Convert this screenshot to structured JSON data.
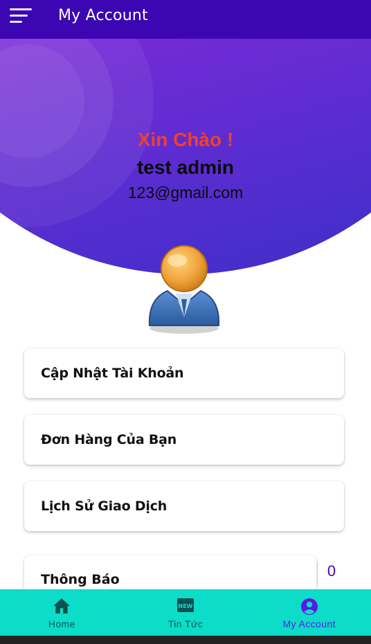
{
  "app_bar": {
    "title": "My Account",
    "menu_icon": "menu-icon"
  },
  "profile": {
    "greeting": "Xin Chào !",
    "name": "test admin",
    "email": "123@gmail.com",
    "avatar_icon": "user-avatar-icon"
  },
  "menu": [
    {
      "label": "Cập Nhật Tài Khoản"
    },
    {
      "label": "Đơn Hàng Của Bạn"
    },
    {
      "label": "Lịch Sử Giao Dịch"
    }
  ],
  "notifications": {
    "label": "Thông Báo",
    "count": "0"
  },
  "bottom_nav": {
    "items": [
      {
        "label": "Home",
        "icon": "home-icon",
        "active": false
      },
      {
        "label": "Tin Tức",
        "icon": "news-icon",
        "active": false
      },
      {
        "label": "My Account",
        "icon": "account-circle-icon",
        "active": true
      }
    ]
  },
  "colors": {
    "app_bar": "#3d06b3",
    "header_gradient_start": "#7a2ad8",
    "header_gradient_end": "#3d2fc8",
    "greeting": "#f1402b",
    "bottom_nav": "#0cdcc8",
    "active_nav": "#5b18e6"
  }
}
